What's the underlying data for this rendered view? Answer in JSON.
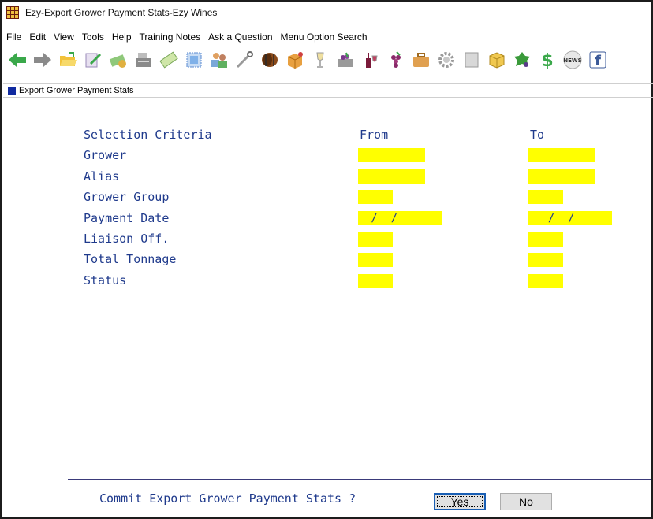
{
  "window": {
    "title": "Ezy-Export Grower Payment Stats-Ezy Wines"
  },
  "menu": [
    "File",
    "Edit",
    "View",
    "Tools",
    "Help",
    "Training Notes",
    "Ask a Question",
    "Menu Option Search"
  ],
  "toolbar": [
    "back-arrow-icon",
    "forward-arrow-icon",
    "open-folder-icon",
    "notepad-icon",
    "payments-icon",
    "cash-register-icon",
    "cheque-icon",
    "stamp-icon",
    "users-icon",
    "wrench-icon",
    "barrel-icon",
    "box-icon",
    "glass-icon",
    "grapes-bin-icon",
    "wine-bottle-icon",
    "grapes-icon",
    "briefcase-icon",
    "gear-icon",
    "sheet-icon",
    "cube-icon",
    "grape-leaf-icon",
    "dollar-icon",
    "news-icon",
    "facebook-icon"
  ],
  "toolbar_labels": {
    "news": "NEWS",
    "facebook": "f"
  },
  "screen": {
    "title": "Export Grower Payment Stats"
  },
  "criteria": {
    "header": "Selection Criteria",
    "from_header": "From",
    "to_header": "To",
    "rows": [
      {
        "label": "Grower",
        "from": "",
        "to": ""
      },
      {
        "label": "Alias",
        "from": "",
        "to": ""
      },
      {
        "label": "Grower Group",
        "from": "",
        "to": ""
      },
      {
        "label": "Payment Date",
        "from": " /  /",
        "to": "  /  /"
      },
      {
        "label": "Liaison Off.",
        "from": "",
        "to": ""
      },
      {
        "label": "Total Tonnage",
        "from": "",
        "to": ""
      },
      {
        "label": "Status",
        "from": "",
        "to": ""
      }
    ]
  },
  "commit": {
    "prompt": "Commit Export Grower Payment Stats ?",
    "yes": "Yes",
    "no": "No"
  },
  "colors": {
    "label_blue": "#1f3a8c",
    "field_yellow": "#ffff00",
    "subbar_square": "#102aa0"
  }
}
